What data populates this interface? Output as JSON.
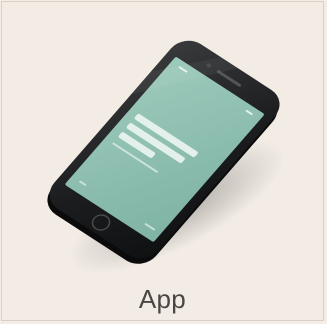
{
  "card": {
    "caption": "App"
  },
  "photo": {
    "subject": "smartphone-mockup",
    "screen_color": "#8dbfb0",
    "body_color": "#1f2021"
  }
}
